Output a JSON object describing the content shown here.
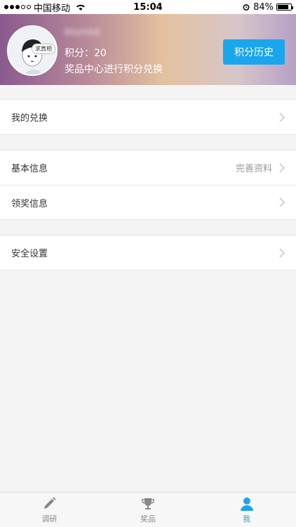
{
  "status_bar": {
    "carrier": "中国移动",
    "time": "15:04",
    "battery": "84%",
    "battery_level": 0.84
  },
  "profile": {
    "avatar_tag": "求真相",
    "username": "blurred",
    "points": "积分：20",
    "hint": "奖品中心进行积分兑换",
    "history_button": "积分历史"
  },
  "menu": {
    "exchange": "我的兑换",
    "basic_info": "基本信息",
    "basic_info_detail": "完善资料",
    "prize_info": "领奖信息",
    "security": "安全设置"
  },
  "tabs": [
    {
      "label": "调研",
      "icon": "pencil-icon",
      "active": false
    },
    {
      "label": "奖品",
      "icon": "trophy-icon",
      "active": false
    },
    {
      "label": "我",
      "icon": "person-icon",
      "active": true
    }
  ],
  "colors": {
    "accent": "#1aa6ec",
    "background": "#f4f4f4"
  }
}
